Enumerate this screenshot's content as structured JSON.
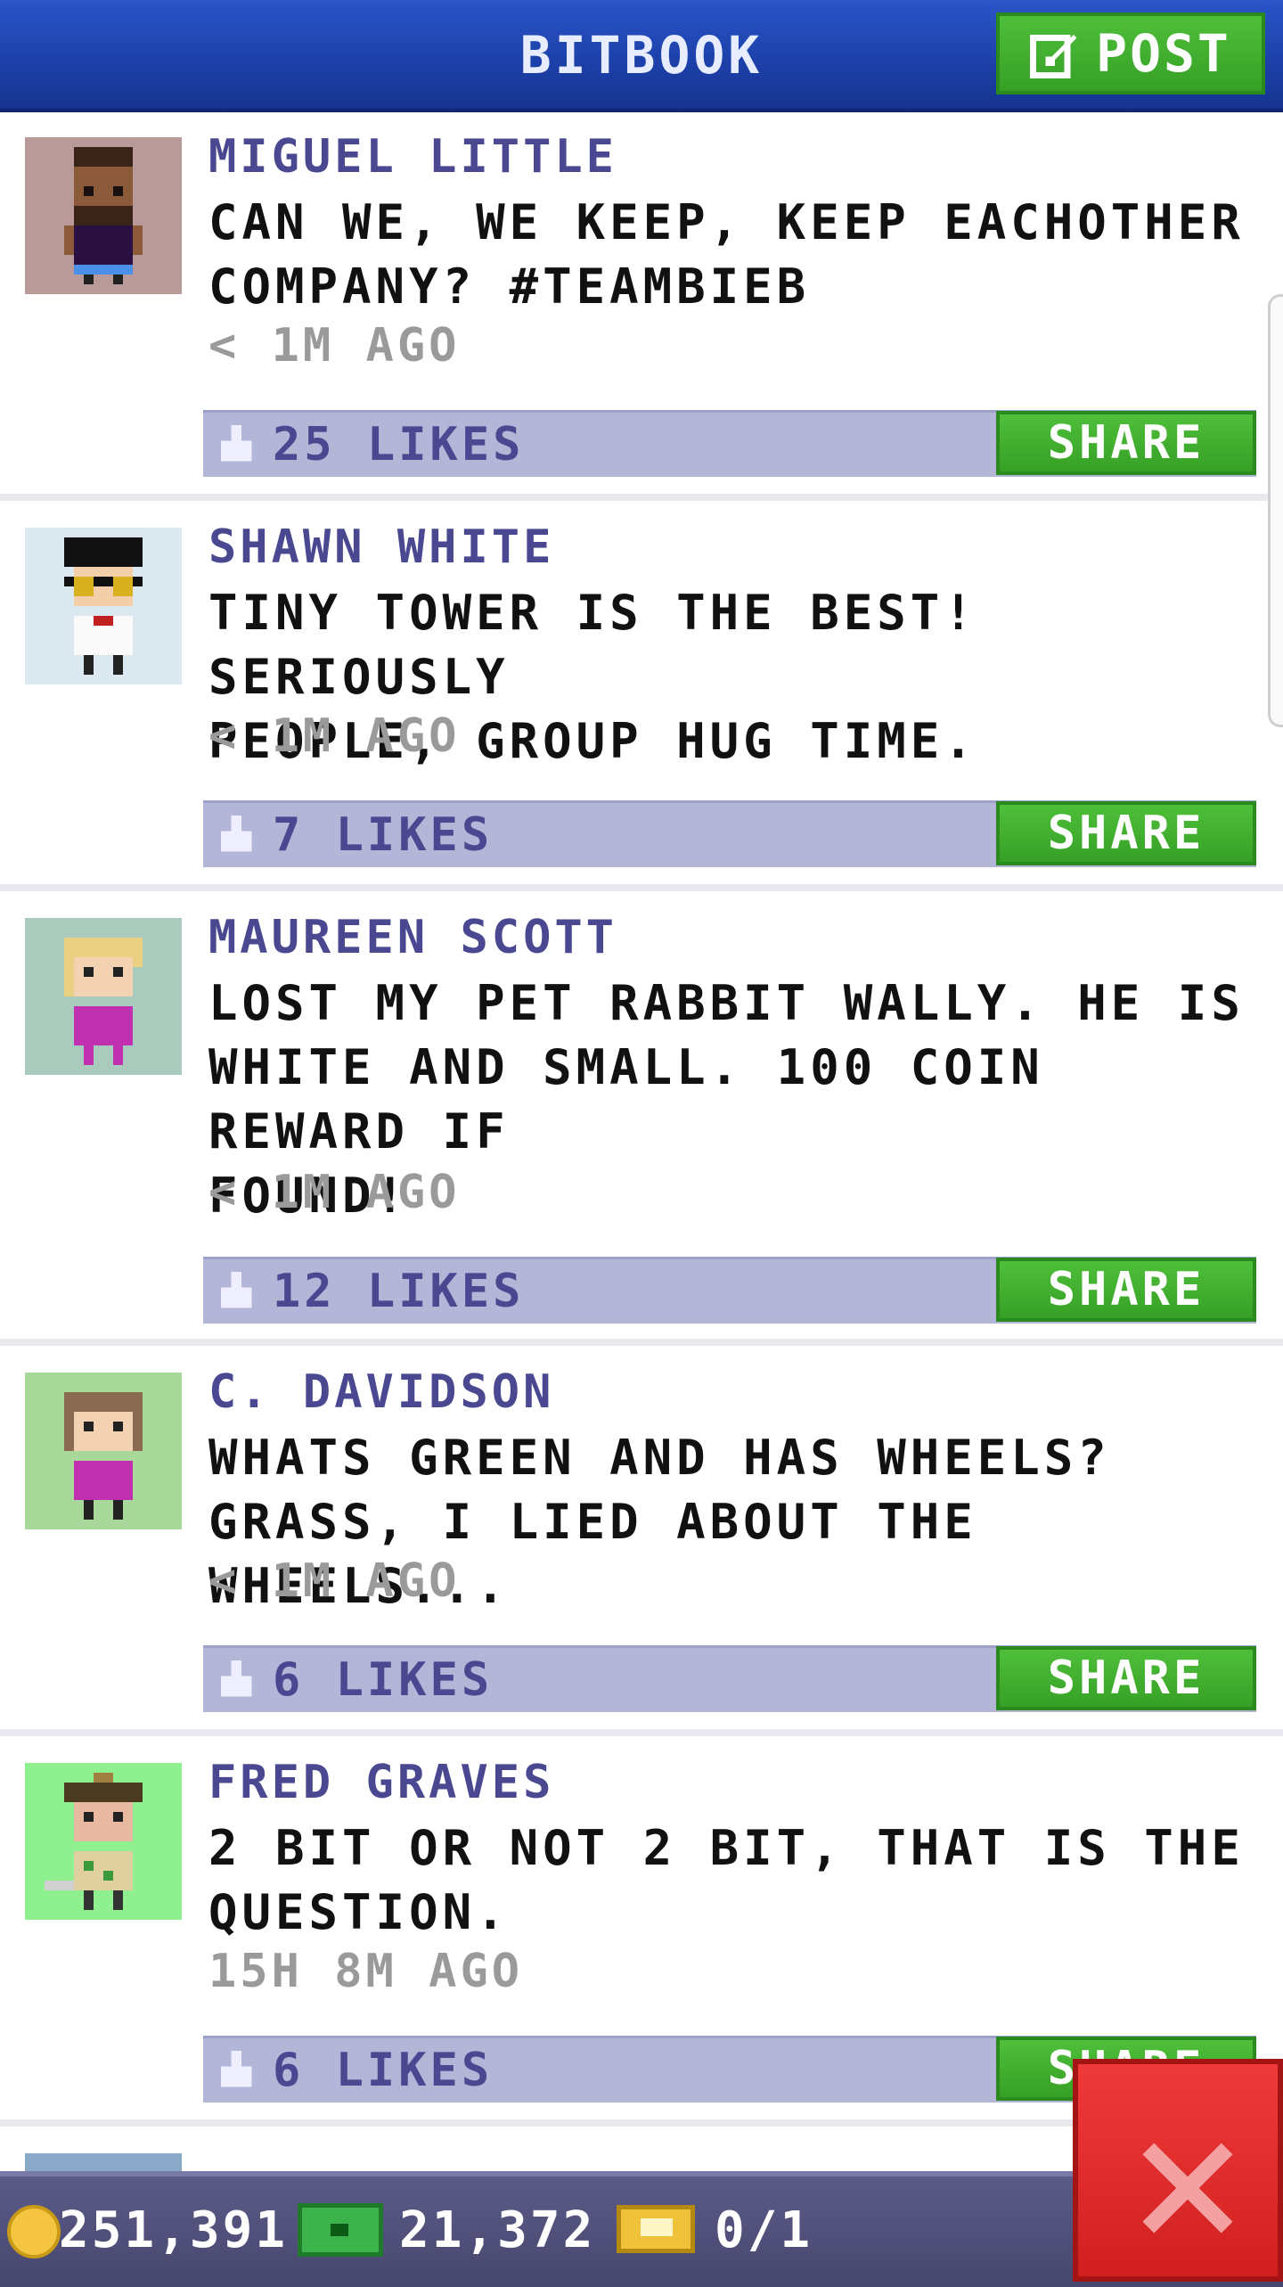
{
  "header": {
    "title": "BITBOOK",
    "post_label": "POST"
  },
  "feed": [
    {
      "name": "MIGUEL LITTLE",
      "lines": [
        "CAN WE, WE KEEP, KEEP EACHOTHER",
        "COMPANY? #TEAMBIEB"
      ],
      "time": "< 1M AGO",
      "likes": "25 LIKES",
      "share": "SHARE",
      "avatar_bg": "#b89a98"
    },
    {
      "name": "SHAWN WHITE",
      "lines": [
        "TINY TOWER IS THE BEST! SERIOUSLY",
        "PEOPLE, GROUP HUG TIME."
      ],
      "time": "< 1M AGO",
      "likes": "7 LIKES",
      "share": "SHARE",
      "avatar_bg": "#dce8f0"
    },
    {
      "name": "MAUREEN SCOTT",
      "lines": [
        "LOST MY PET RABBIT WALLY. HE IS",
        "WHITE AND SMALL. 100 COIN REWARD IF",
        "FOUND!"
      ],
      "time": "< 1M AGO",
      "likes": "12 LIKES",
      "share": "SHARE",
      "avatar_bg": "#a8cbbd"
    },
    {
      "name": "C. DAVIDSON",
      "lines": [
        "WHATS GREEN AND HAS WHEELS?",
        "GRASS, I LIED ABOUT THE WHEELS..."
      ],
      "time": "< 1M AGO",
      "likes": "6 LIKES",
      "share": "SHARE",
      "avatar_bg": "#a8d79a"
    },
    {
      "name": "FRED GRAVES",
      "lines": [
        "2 BIT OR NOT 2 BIT, THAT IS THE",
        "QUESTION."
      ],
      "time": "15H 8M AGO",
      "likes": "6 LIKES",
      "share": "SHARE",
      "avatar_bg": "#8ef08e"
    }
  ],
  "bottom": {
    "coins": "251,391",
    "bux": "21,372",
    "tickets": "0/1"
  },
  "colors": {
    "header": "#1c3fa8",
    "share_green": "#3fae2e",
    "likebar": "#b4b6d8",
    "close_red": "#e02a2a"
  },
  "icons": [
    "edit-icon",
    "thumbs-up-icon",
    "coin-icon",
    "bux-icon",
    "ticket-icon",
    "close-icon"
  ]
}
